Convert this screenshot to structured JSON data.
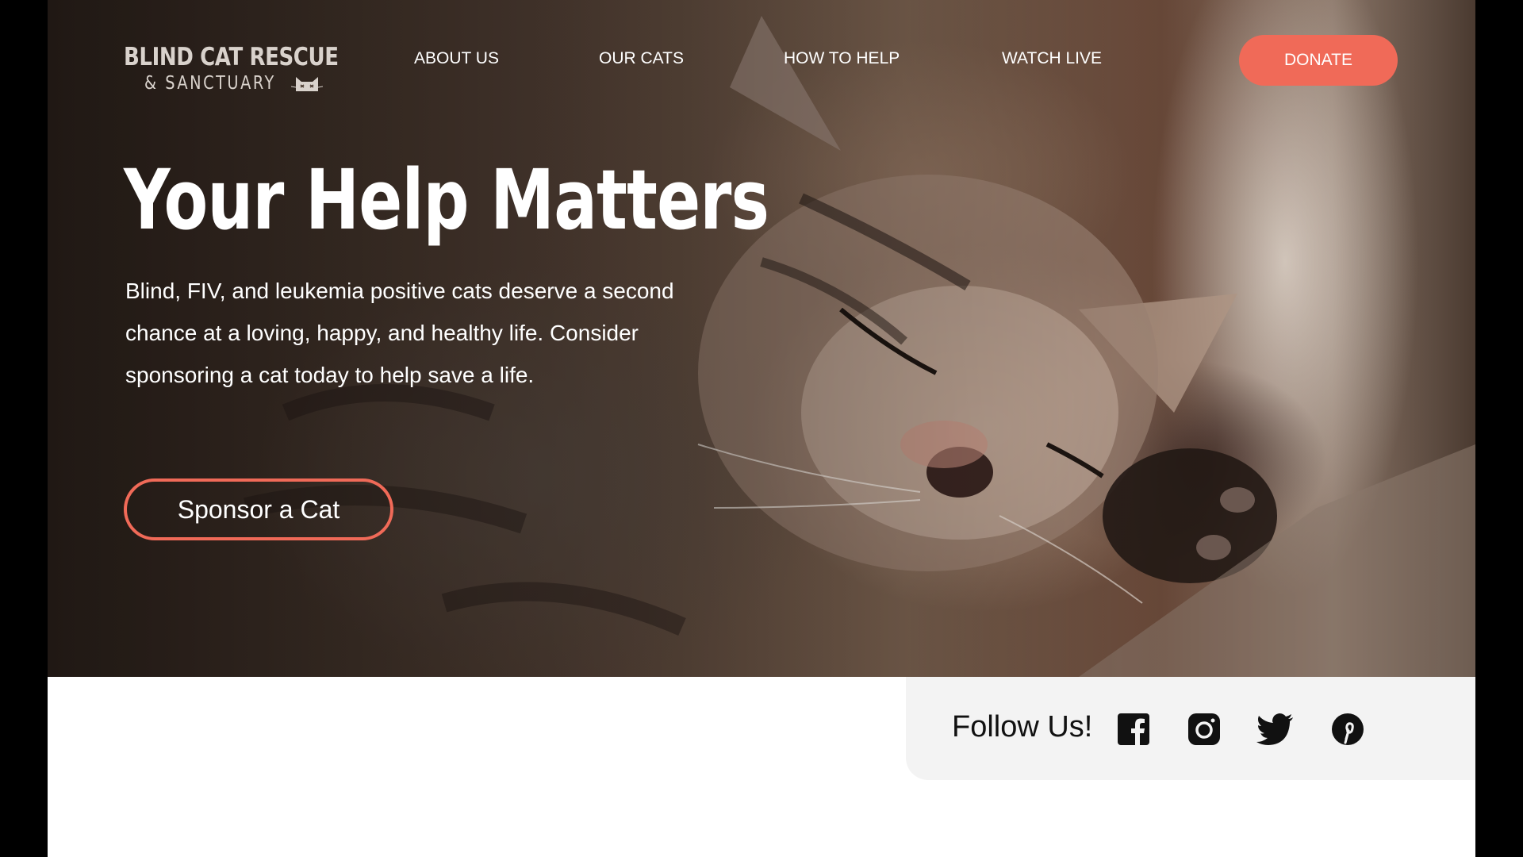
{
  "brand": {
    "title": "BLIND CAT RESCUE",
    "subtitle": "& SANCTUARY",
    "logo_icon": "cat-face-icon"
  },
  "nav": {
    "items": [
      {
        "label": "ABOUT US"
      },
      {
        "label": "OUR CATS"
      },
      {
        "label": "HOW TO HELP"
      },
      {
        "label": "WATCH LIVE"
      }
    ],
    "donate_label": "DONATE"
  },
  "hero": {
    "title": "Your Help Matters",
    "body": "Blind, FIV, and leukemia positive cats deserve a second chance at a loving, happy, and healthy life. Consider sponsoring a cat today to help save a life.",
    "cta_label": "Sponsor a Cat",
    "image_subject": "sleeping tabby kitten"
  },
  "follow": {
    "label": "Follow Us!",
    "icons": [
      "facebook-icon",
      "instagram-icon",
      "twitter-icon",
      "pinterest-icon"
    ]
  },
  "colors": {
    "accent": "#f06a58",
    "follow_bg": "#f3f3f3",
    "page_bg": "#ffffff",
    "frame_bg": "#000000"
  }
}
